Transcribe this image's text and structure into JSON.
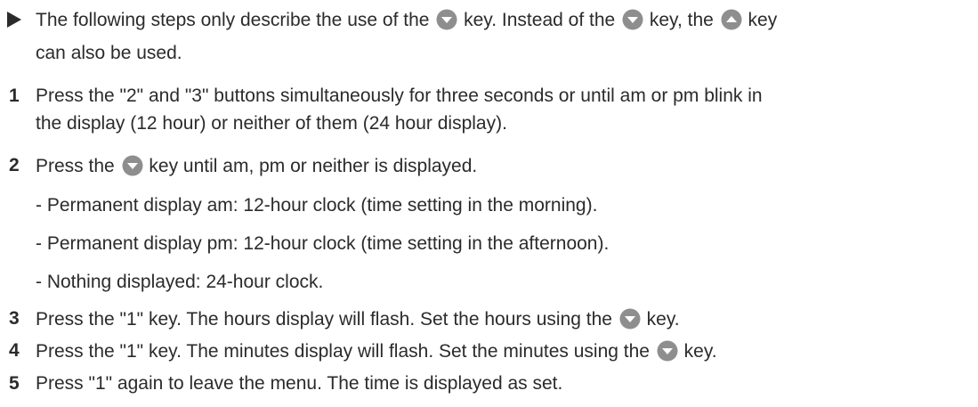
{
  "note": {
    "marker_icon": "triangle-right-icon",
    "line1_part1": "The following steps only describe the use of the",
    "line1_part2": "key. Instead of the",
    "line1_part3": "key, the",
    "line1_part4": "key",
    "line2": "can also be used."
  },
  "steps": [
    {
      "number": "1",
      "line1": "Press the \"2\" and \"3\" buttons simultaneously for three seconds or until am or pm blink in",
      "line2": "the display (12 hour) or neither of them (24 hour display)."
    },
    {
      "number": "2",
      "part1": "Press the",
      "part2": "key until am, pm or neither is displayed.",
      "options": [
        "- Permanent display am: 12-hour clock (time setting in the morning).",
        "- Permanent display pm: 12-hour clock (time setting in the afternoon).",
        "- Nothing displayed: 24-hour clock."
      ]
    },
    {
      "number": "3",
      "part1": "Press the \"1\" key. The hours display will flash. Set the hours using the",
      "part2": "key."
    },
    {
      "number": "4",
      "part1": "Press the \"1\" key. The minutes display will flash. Set the minutes using the",
      "part2": "key."
    },
    {
      "number": "5",
      "line1": "Press \"1\" again to leave the menu. The time is displayed as set."
    }
  ],
  "colors": {
    "text": "#2b2b2b",
    "key_fill": "#8e8e8e",
    "key_arrow": "#ffffff"
  },
  "icons": {
    "down_key": "down-key-icon",
    "up_key": "up-key-icon"
  }
}
